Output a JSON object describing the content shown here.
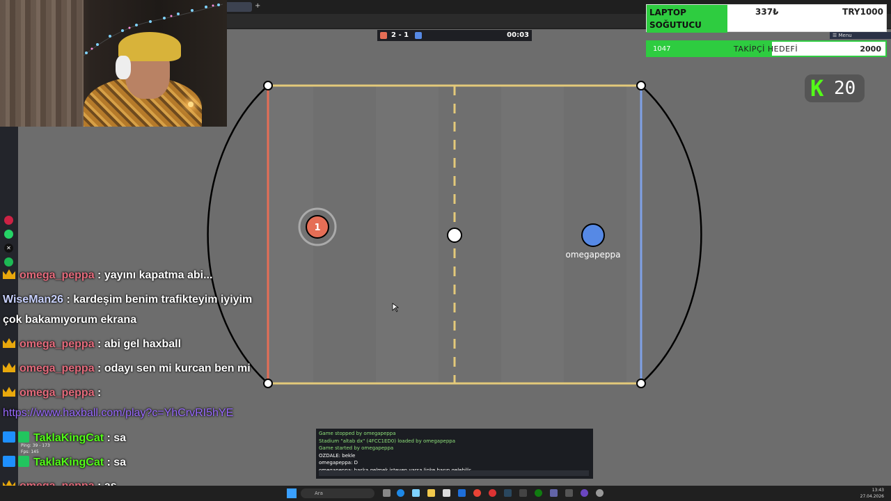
{
  "browser": {
    "tab_label": "y",
    "newtab_symbol": "+"
  },
  "webcam": {
    "description_icon": "webcam-feed"
  },
  "game": {
    "score_red": 2,
    "score_blue": 1,
    "score_text": "2 - 1",
    "time": "00:03",
    "red_player_number": "1",
    "blue_player_name": "omegapeppa"
  },
  "donation_goal": {
    "label": "LAPTOP SOĞUTUCU",
    "current": "337₺",
    "target": "TRY1000"
  },
  "mini_menu": {
    "label": "☰ Menu"
  },
  "follower_goal": {
    "current": "1047",
    "label": "TAKİPÇİ HEDEFİ",
    "target": "2000",
    "progress": 0.5235
  },
  "kick": {
    "count": "20"
  },
  "chat": [
    {
      "badge": "crown",
      "user": "omega_peppa",
      "user_class": "u-omega",
      "text": " : yayını kapatma abi..."
    },
    {
      "badge": "",
      "user": "WiseMan26",
      "user_class": "u-wise",
      "text": " : kardeşim benim trafikteyim iyiyim"
    },
    {
      "badge": "",
      "user": "",
      "user_class": "",
      "text": "çok bakamıyorum ekrana"
    },
    {
      "badge": "crown",
      "user": "omega_peppa",
      "user_class": "u-omega",
      "text": " : abi gel haxball"
    },
    {
      "badge": "crown",
      "user": "omega_peppa",
      "user_class": "u-omega",
      "text": " : odayı sen mi kurcan ben mi"
    },
    {
      "badge": "crown",
      "user": "omega_peppa",
      "user_class": "u-omega",
      "text": " :"
    },
    {
      "badge": "",
      "user": "",
      "user_class": "",
      "text": "https://www.haxball.com/play?c=YhCrvRI5hYE",
      "link": true
    },
    {
      "badge": "sub",
      "user": "TaklaKingCat",
      "user_class": "u-takla",
      "text": " : sa"
    },
    {
      "badge": "sub",
      "user": "TaklaKingCat",
      "user_class": "u-takla",
      "text": " : sa"
    },
    {
      "badge": "crown",
      "user": "omega_peppa",
      "user_class": "u-omega",
      "text": " : as"
    }
  ],
  "ping": {
    "line1": "Ping: 39 - 173",
    "line2": "Fps: 145"
  },
  "log": [
    {
      "text": "Game stopped by omegapeppa",
      "sys": true
    },
    {
      "text": "Stadium \"altab dx\" (4FCC1ED0) loaded by omegapeppa",
      "sys": true
    },
    {
      "text": "Game started by omegapeppa",
      "sys": true
    },
    {
      "text": "OZDALE: bekle",
      "sys": false
    },
    {
      "text": "omegapeppa: D",
      "sys": false
    },
    {
      "text": "omegapeppa: başka gelmek isteyen varsa linke basıp gelebilir",
      "sys": false
    }
  ],
  "taskbar": {
    "search_placeholder": "Ara",
    "time": "13:43",
    "date": "27.04.2026"
  },
  "colors": {
    "red_team": "#e56e56",
    "blue_team": "#5689e5",
    "field_line": "#e3c97a",
    "kick_green": "#53fc18",
    "goal_green": "#2ecc40"
  }
}
